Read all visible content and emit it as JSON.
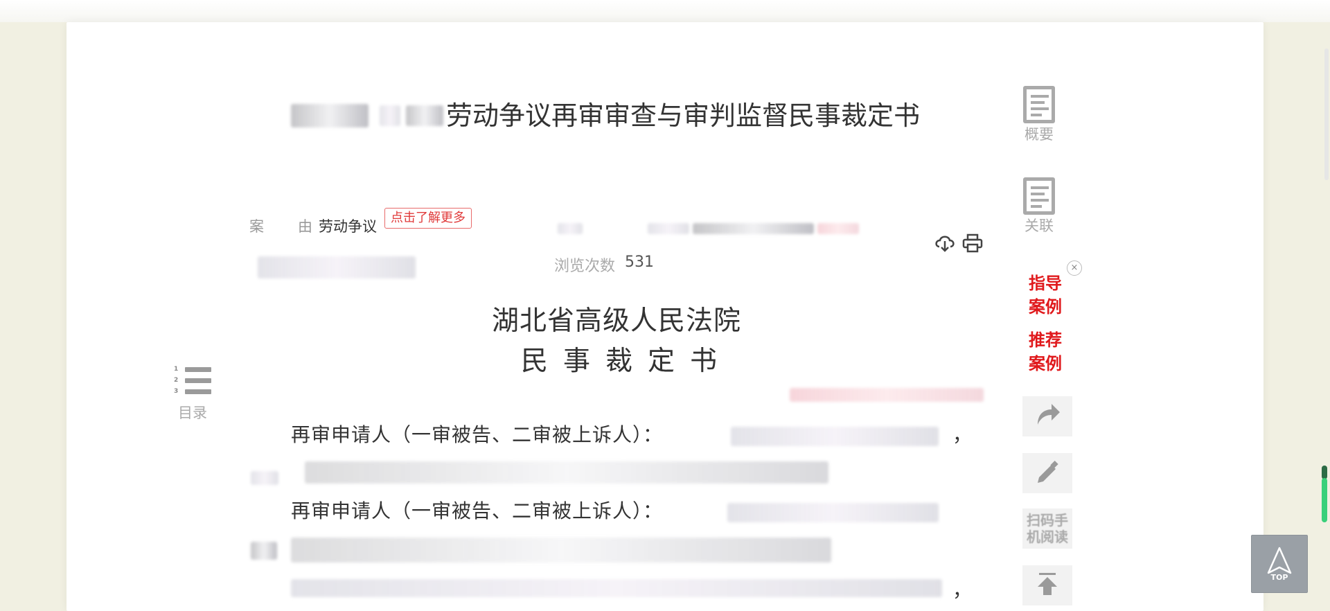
{
  "document": {
    "title_suffix": "劳动争议再审审查与审判监督民事裁定书",
    "cause_label_1": "案",
    "cause_label_2": "由",
    "cause_value": "劳动争议",
    "learn_more": "点击了解更多",
    "views_label": "浏览次数",
    "views_count": "531",
    "court_name": "湖北省高级人民法院",
    "doc_type": "民事裁定书",
    "paragraphs": [
      "再审申请人（一审被告、二审被上诉人）：",
      "再审申请人（一审被告、二审被上诉人）："
    ],
    "comma": "，"
  },
  "left_tools": {
    "toc_label": "目录",
    "toc_numbers": [
      "1",
      "2",
      "3"
    ]
  },
  "right_tools": {
    "summary_label": "概要",
    "related_label": "关联",
    "guide_cases": "指导案例",
    "guide_line1": "指导",
    "guide_line2": "案例",
    "recommend_line1": "推荐",
    "recommend_line2": "案例",
    "close_symbol": "×",
    "qr_line1": "扫码手",
    "qr_line2": "机阅读",
    "share_icon": "share-arrow-icon",
    "edit_icon": "pencil-icon",
    "scroll_up_icon": "up-arrow-icon"
  },
  "back_to_top": {
    "label": "TOP"
  },
  "colors": {
    "background": "#f1f0e2",
    "panel": "#ffffff",
    "accent_red": "#e0191c",
    "scroll_green": "#39d07a"
  }
}
